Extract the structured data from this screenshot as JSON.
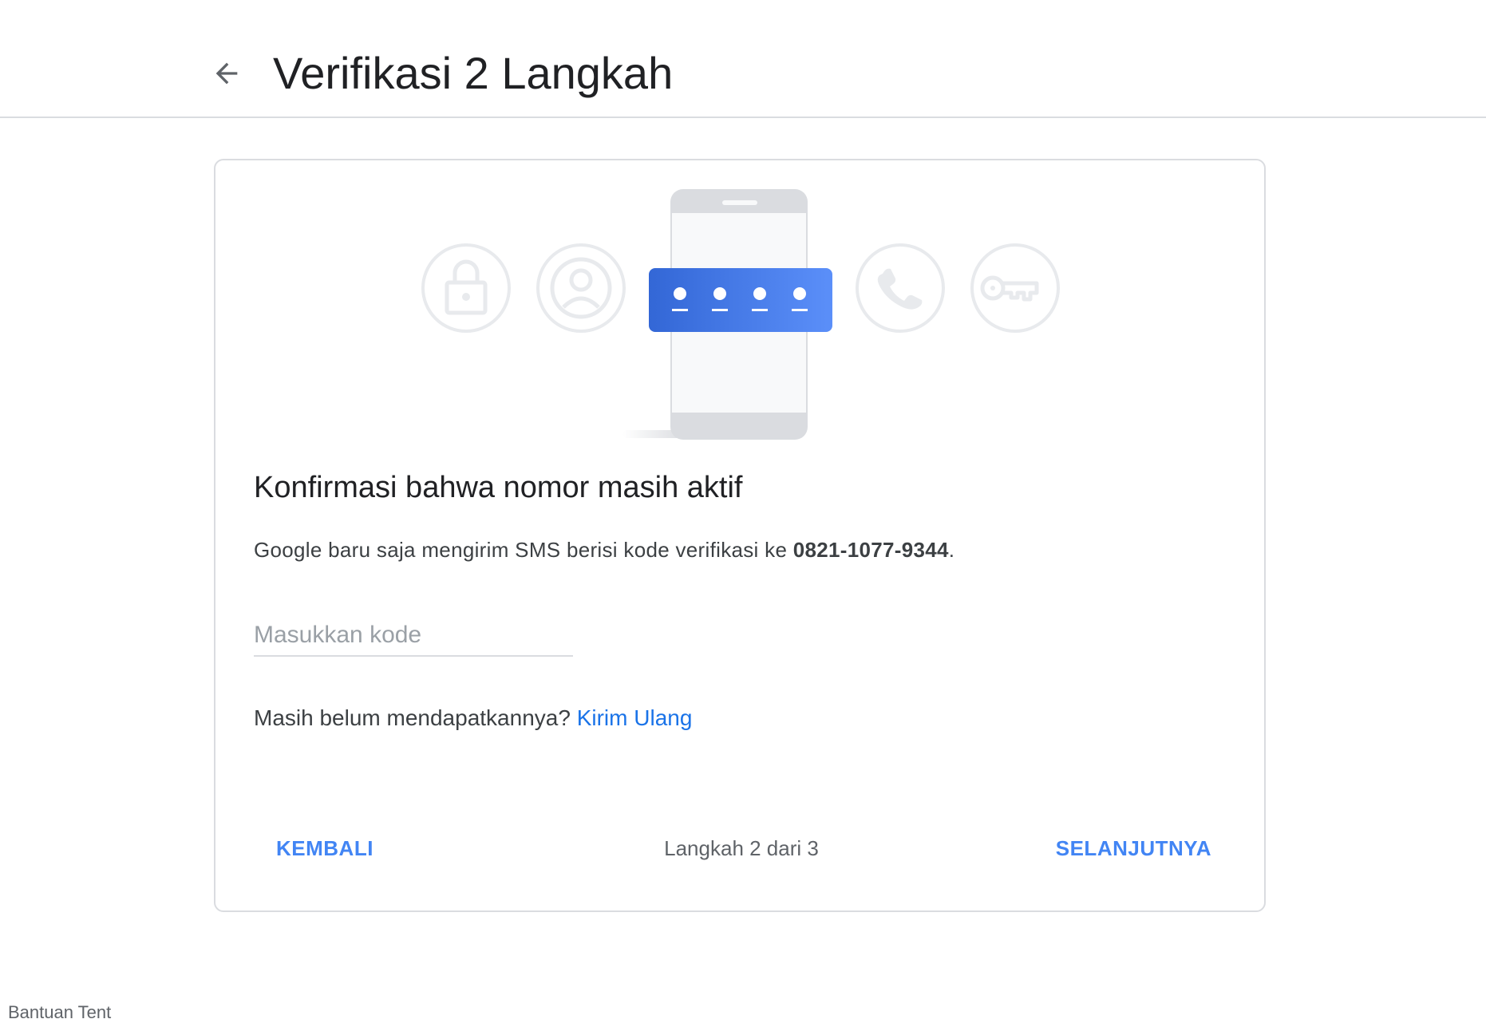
{
  "header": {
    "title": "Verifikasi 2 Langkah",
    "back_icon": "arrow-back-icon"
  },
  "illustration": {
    "icons": [
      "lock-icon",
      "account-circle-icon",
      "sms-code-icon",
      "phone-icon",
      "key-icon"
    ],
    "accent_gradient": [
      "#3367d6",
      "#5b8ff9"
    ],
    "icon_ring_color": "#e8eaed"
  },
  "card": {
    "heading": "Konfirmasi bahwa nomor masih aktif",
    "description_prefix": "Google baru saja mengirim SMS berisi kode verifikasi ke ",
    "phone_number": "0821-1077-9344",
    "description_suffix": ".",
    "code_input": {
      "placeholder": "Masukkan kode",
      "value": ""
    },
    "resend_prompt": "Masih belum mendapatkannya?",
    "resend_link": "Kirim Ulang"
  },
  "footer": {
    "back_label": "KEMBALI",
    "step_text": "Langkah 2 dari 3",
    "next_label": "SELANJUTNYA"
  },
  "colors": {
    "accent": "#4285f4",
    "link": "#1a73e8",
    "border": "#dadce0"
  },
  "bottom_partial_text": "Bantuan   Tent"
}
